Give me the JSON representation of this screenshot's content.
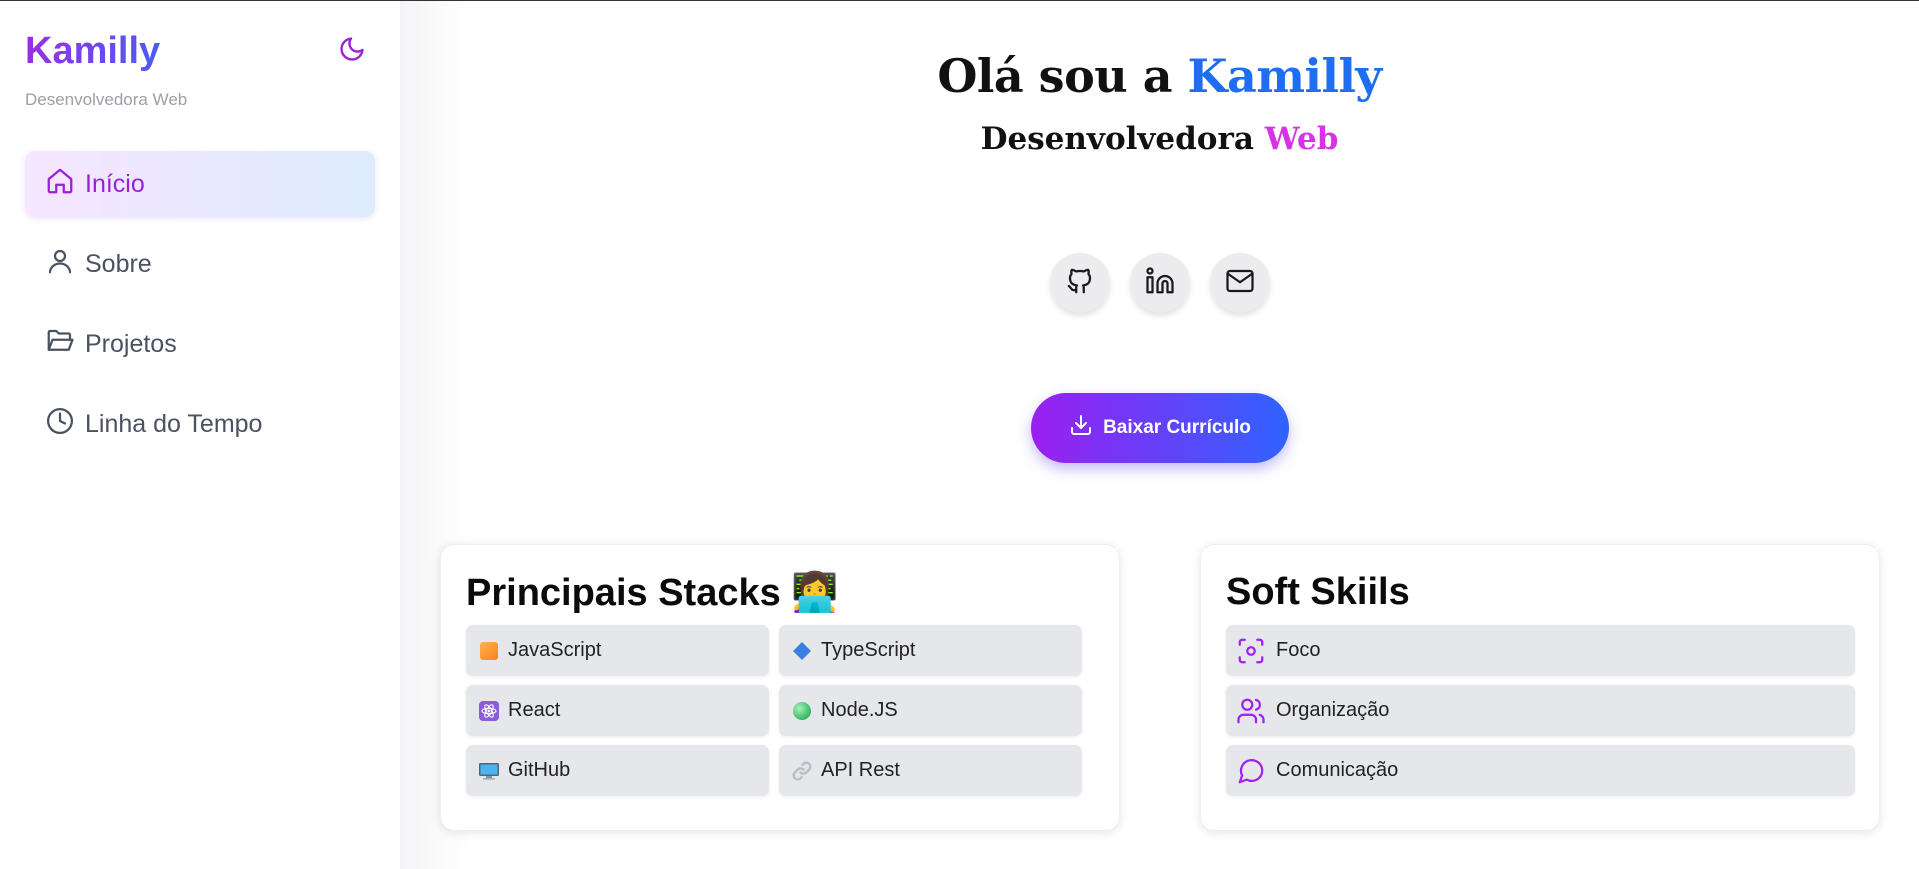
{
  "sidebar": {
    "brand": "Kamilly",
    "tagline": "Desenvolvedora Web",
    "theme_toggle_icon": "moon-icon",
    "items": [
      {
        "label": "Início",
        "icon": "home-icon",
        "active": true
      },
      {
        "label": "Sobre",
        "icon": "user-icon",
        "active": false
      },
      {
        "label": "Projetos",
        "icon": "folder-open-icon",
        "active": false
      },
      {
        "label": "Linha do Tempo",
        "icon": "clock-icon",
        "active": false
      }
    ]
  },
  "hero": {
    "title_prefix": "Olá sou a ",
    "title_highlight": "Kamilly",
    "subtitle_prefix": "Desenvolvedora ",
    "subtitle_highlight": "Web",
    "socials": [
      {
        "icon": "github-icon"
      },
      {
        "icon": "linkedin-icon"
      },
      {
        "icon": "mail-icon"
      }
    ],
    "cta_label": "Baixar Currículo",
    "cta_icon": "download-icon"
  },
  "stacks": {
    "title": "Principais Stacks 👩‍💻",
    "items": [
      {
        "label": "JavaScript",
        "icon": "orange-square-icon"
      },
      {
        "label": "TypeScript",
        "icon": "blue-diamond-icon"
      },
      {
        "label": "React",
        "icon": "atom-icon"
      },
      {
        "label": "Node.JS",
        "icon": "green-circle-icon"
      },
      {
        "label": "GitHub",
        "icon": "computer-icon"
      },
      {
        "label": "API Rest",
        "icon": "link-icon"
      }
    ]
  },
  "soft": {
    "title": "Soft Skiils",
    "items": [
      {
        "label": "Foco",
        "icon": "focus-icon"
      },
      {
        "label": "Organização",
        "icon": "users-icon"
      },
      {
        "label": "Comunicação",
        "icon": "message-circle-icon"
      }
    ]
  },
  "colors": {
    "accent_purple": "#9a1fd8",
    "accent_blue": "#1f6ef2",
    "accent_pink": "#d633e6",
    "chip_bg": "#e6e7ea"
  }
}
